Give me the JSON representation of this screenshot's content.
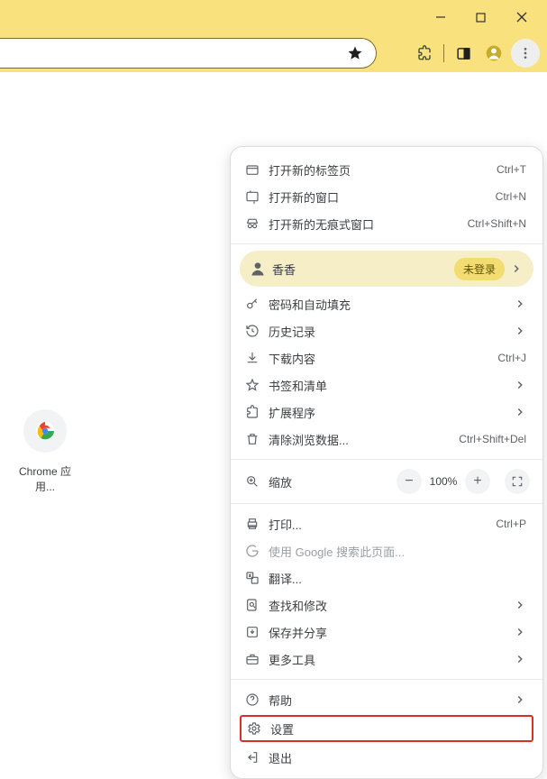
{
  "shortcut_label": "Chrome 应用...",
  "profile": {
    "name": "香香",
    "status": "未登录"
  },
  "zoom": {
    "label": "缩放",
    "level": "100%"
  },
  "items": {
    "new_tab": {
      "label": "打开新的标签页",
      "shortcut": "Ctrl+T"
    },
    "new_window": {
      "label": "打开新的窗口",
      "shortcut": "Ctrl+N"
    },
    "incognito": {
      "label": "打开新的无痕式窗口",
      "shortcut": "Ctrl+Shift+N"
    },
    "passwords": {
      "label": "密码和自动填充"
    },
    "history": {
      "label": "历史记录"
    },
    "downloads": {
      "label": "下载内容",
      "shortcut": "Ctrl+J"
    },
    "bookmarks": {
      "label": "书签和清单"
    },
    "extensions": {
      "label": "扩展程序"
    },
    "clear_data": {
      "label": "清除浏览数据...",
      "shortcut": "Ctrl+Shift+Del"
    },
    "print": {
      "label": "打印...",
      "shortcut": "Ctrl+P"
    },
    "google_search": {
      "label": "使用 Google 搜索此页面..."
    },
    "translate": {
      "label": "翻译..."
    },
    "find_edit": {
      "label": "查找和修改"
    },
    "save_share": {
      "label": "保存并分享"
    },
    "more_tools": {
      "label": "更多工具"
    },
    "help": {
      "label": "帮助"
    },
    "settings": {
      "label": "设置"
    },
    "exit": {
      "label": "退出"
    }
  }
}
